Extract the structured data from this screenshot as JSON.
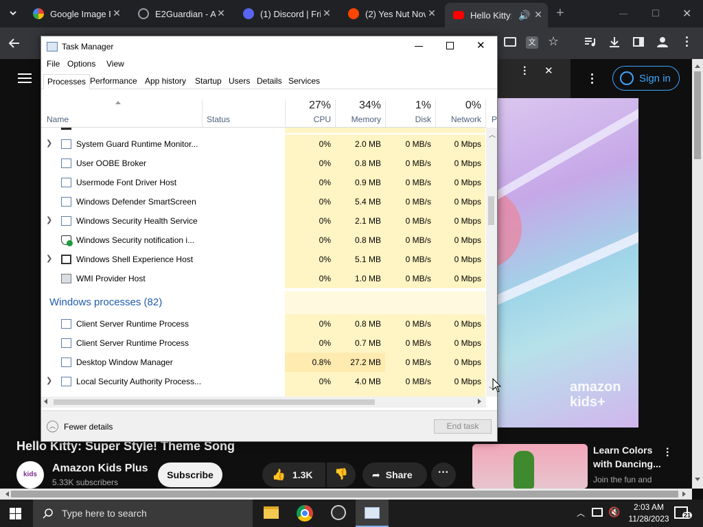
{
  "browser": {
    "tabs": [
      {
        "title": "Google Image R",
        "color": "#ffffff"
      },
      {
        "title": "E2Guardian - A",
        "color": "#9aa0a6"
      },
      {
        "title": "(1) Discord | Fri",
        "color": "#5865f2"
      },
      {
        "title": "(2) Yes Nut Nov",
        "color": "#ff4500"
      },
      {
        "title": "Hello Kitty:",
        "color": "#ff0000"
      }
    ],
    "new_tab": "+"
  },
  "youtube": {
    "sign_in": "Sign in",
    "video_title": "Hello Kitty: Super Style! Theme Song",
    "channel": "Amazon Kids Plus",
    "subscribers": "5.33K subscribers",
    "subscribe": "Subscribe",
    "likes": "1.3K",
    "share": "Share",
    "watermark": "amazon kids+",
    "rec_title": "Learn Colors with Dancing...",
    "rec_sub": "Join the fun and"
  },
  "taskmanager": {
    "title": "Task Manager",
    "menu": [
      "File",
      "Options",
      "View"
    ],
    "tabs": [
      "Processes",
      "Performance",
      "App history",
      "Startup",
      "Users",
      "Details",
      "Services"
    ],
    "cols": {
      "name": "Name",
      "status": "Status",
      "cpu": "CPU",
      "memory": "Memory",
      "disk": "Disk",
      "network": "Network",
      "p": "P"
    },
    "usage": {
      "cpu": "27%",
      "memory": "34%",
      "disk": "1%",
      "network": "0%"
    },
    "rows": [
      {
        "name": "System Guard Runtime Monitor...",
        "cpu": "0%",
        "mem": "2.0 MB",
        "disk": "0 MB/s",
        "net": "0 Mbps",
        "expand": true
      },
      {
        "name": "User OOBE Broker",
        "cpu": "0%",
        "mem": "0.8 MB",
        "disk": "0 MB/s",
        "net": "0 Mbps",
        "expand": false
      },
      {
        "name": "Usermode Font Driver Host",
        "cpu": "0%",
        "mem": "0.9 MB",
        "disk": "0 MB/s",
        "net": "0 Mbps",
        "expand": false
      },
      {
        "name": "Windows Defender SmartScreen",
        "cpu": "0%",
        "mem": "5.4 MB",
        "disk": "0 MB/s",
        "net": "0 Mbps",
        "expand": false
      },
      {
        "name": "Windows Security Health Service",
        "cpu": "0%",
        "mem": "2.1 MB",
        "disk": "0 MB/s",
        "net": "0 Mbps",
        "expand": true
      },
      {
        "name": "Windows Security notification i...",
        "cpu": "0%",
        "mem": "0.8 MB",
        "disk": "0 MB/s",
        "net": "0 Mbps",
        "expand": false
      },
      {
        "name": "Windows Shell Experience Host",
        "cpu": "0%",
        "mem": "5.1 MB",
        "disk": "0 MB/s",
        "net": "0 Mbps",
        "expand": true
      },
      {
        "name": "WMI Provider Host",
        "cpu": "0%",
        "mem": "1.0 MB",
        "disk": "0 MB/s",
        "net": "0 Mbps",
        "expand": false
      }
    ],
    "group": "Windows processes (82)",
    "rows2": [
      {
        "name": "Client Server Runtime Process",
        "cpu": "0%",
        "mem": "0.8 MB",
        "disk": "0 MB/s",
        "net": "0 Mbps",
        "expand": false
      },
      {
        "name": "Client Server Runtime Process",
        "cpu": "0%",
        "mem": "0.7 MB",
        "disk": "0 MB/s",
        "net": "0 Mbps",
        "expand": false
      },
      {
        "name": "Desktop Window Manager",
        "cpu": "0.8%",
        "mem": "27.2 MB",
        "disk": "0 MB/s",
        "net": "0 Mbps",
        "expand": false
      },
      {
        "name": "Local Security Authority Process...",
        "cpu": "0%",
        "mem": "4.0 MB",
        "disk": "0 MB/s",
        "net": "0 Mbps",
        "expand": true
      }
    ],
    "fewer": "Fewer details",
    "end_task": "End task"
  },
  "taskbar": {
    "search": "Type here to search",
    "time": "2:03 AM",
    "date": "11/28/2023",
    "notif": "21"
  }
}
